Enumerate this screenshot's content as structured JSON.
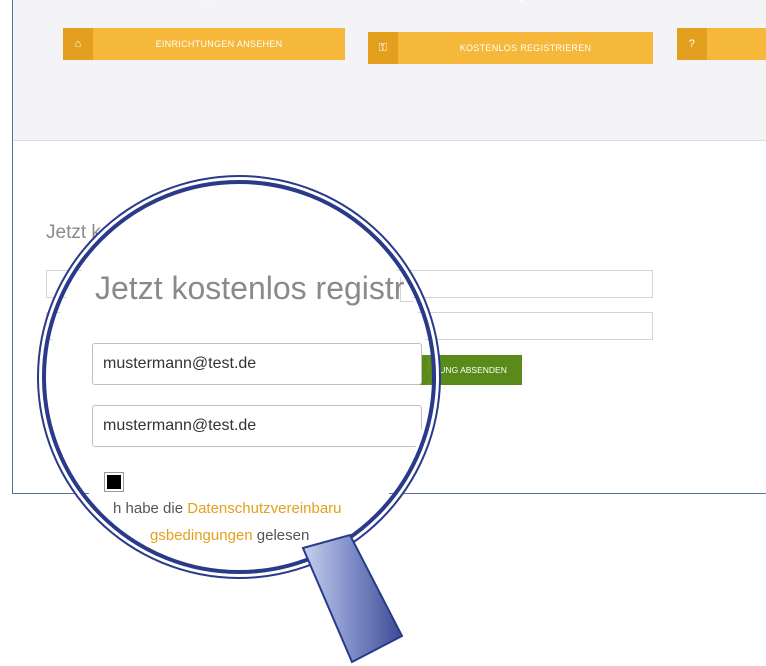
{
  "nav": {
    "items": [
      {
        "label": "EINRICHTUNGEN ANSEHEN",
        "icon": "home-icon"
      },
      {
        "label": "KOSTENLOS REGISTRIEREN",
        "icon": "key-icon"
      },
      {
        "label": "",
        "icon": "help-icon"
      }
    ]
  },
  "form": {
    "title_truncated": "Jetzt k",
    "title": "Jetzt kostenlos registr",
    "email_value": "mustermann@test.de",
    "email_confirm_value": "mustermann@test.de",
    "submit_label": "RUNG ABSENDEN",
    "consent_prefix": "h habe die",
    "consent_link1": "Datenschutzvereinbaru",
    "consent_link2": "gsbedingungen",
    "consent_suffix": "gelesen"
  },
  "colors": {
    "accent": "#f5b83a",
    "submit": "#5a8a1a",
    "lens": "#2a3a8a"
  }
}
